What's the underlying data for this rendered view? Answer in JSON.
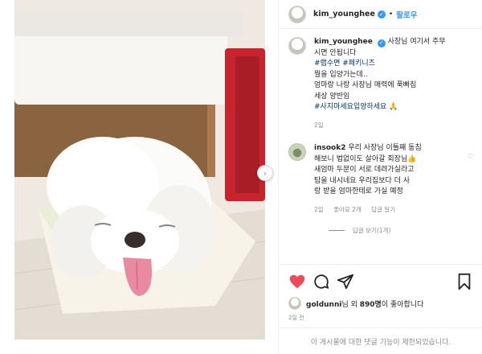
{
  "post": {
    "author": "kim_younghee",
    "follow_label": "팔로우",
    "caption": {
      "line1": "사장님 여기서 주무",
      "line2": "시면 안됩니다",
      "tags1": "#랩수면 #페키니즈",
      "line3": "뭘을 입양가는데..",
      "line4": "엄마랑 나랑 사장님 매력에 푹빠짐",
      "line5": "세상 양반임",
      "tags2": "#사지마세요입양하세요",
      "emoji": "🙏",
      "time": "2일"
    }
  },
  "comment": {
    "username": "insook2",
    "lines": [
      "우리 사장님 이틀째 동침",
      "해보니 법없이도 살아갈 회장님👍",
      "새엄마 두분이 서로 데려가실라고",
      "탐을 내시네요 우리집보다 더 사",
      "랑 받을 엄마한테로 가실 예정"
    ],
    "time": "2일",
    "likes": "좋아요 2개",
    "reply_label": "답글 달기",
    "view_replies": "답글 보기(1개)"
  },
  "likes": {
    "user": "goldunni",
    "suffix_pre": "님 외 ",
    "count": "890명",
    "suffix_post": "이 좋아합니다"
  },
  "timestamp": "2일 전",
  "comments_disabled": "이 게시물에 대한 댓글 기능이 제한되었습니다.",
  "icons": {
    "like": "heart-icon",
    "comment": "comment-icon",
    "share": "share-icon",
    "save": "bookmark-icon",
    "next": "chevron-right-icon"
  },
  "colors": {
    "like_red": "#ed4956",
    "link_blue": "#3897f0",
    "hashtag": "#003569",
    "muted": "#8e8e8e"
  }
}
